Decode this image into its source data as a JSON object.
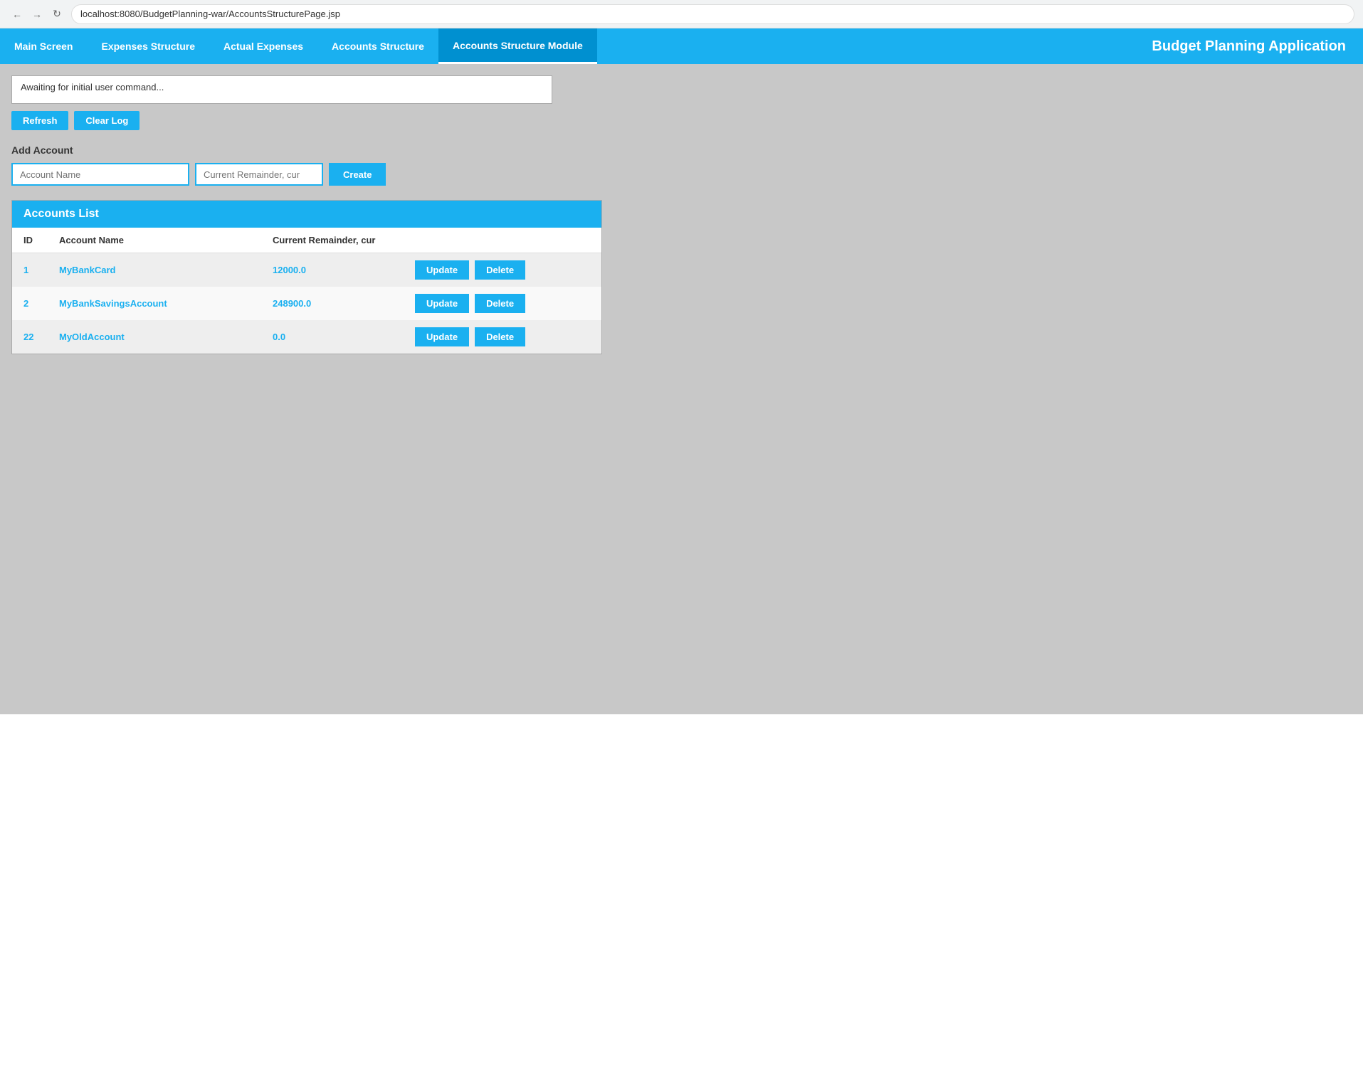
{
  "browser": {
    "url": "localhost:8080/BudgetPlanning-war/AccountsStructurePage.jsp"
  },
  "header": {
    "app_title": "Budget Planning Application",
    "tabs": [
      {
        "id": "main-screen",
        "label": "Main Screen",
        "active": false
      },
      {
        "id": "expenses-structure",
        "label": "Expenses Structure",
        "active": false
      },
      {
        "id": "actual-expenses",
        "label": "Actual Expenses",
        "active": false
      },
      {
        "id": "accounts-structure",
        "label": "Accounts Structure",
        "active": false
      },
      {
        "id": "accounts-structure-module",
        "label": "Accounts Structure Module",
        "active": true
      }
    ]
  },
  "log": {
    "message": "Awaiting for initial user command...",
    "refresh_label": "Refresh",
    "clear_log_label": "Clear Log"
  },
  "add_account": {
    "section_title": "Add Account",
    "name_placeholder": "Account Name",
    "remainder_placeholder": "Current Remainder, cur",
    "create_label": "Create"
  },
  "accounts_list": {
    "title": "Accounts List",
    "columns": {
      "id": "ID",
      "name": "Account Name",
      "remainder": "Current Remainder, cur"
    },
    "rows": [
      {
        "id": "1",
        "name": "MyBankCard",
        "remainder": "12000.0"
      },
      {
        "id": "2",
        "name": "MyBankSavingsAccount",
        "remainder": "248900.0"
      },
      {
        "id": "22",
        "name": "MyOldAccount",
        "remainder": "0.0"
      }
    ],
    "update_label": "Update",
    "delete_label": "Delete"
  }
}
